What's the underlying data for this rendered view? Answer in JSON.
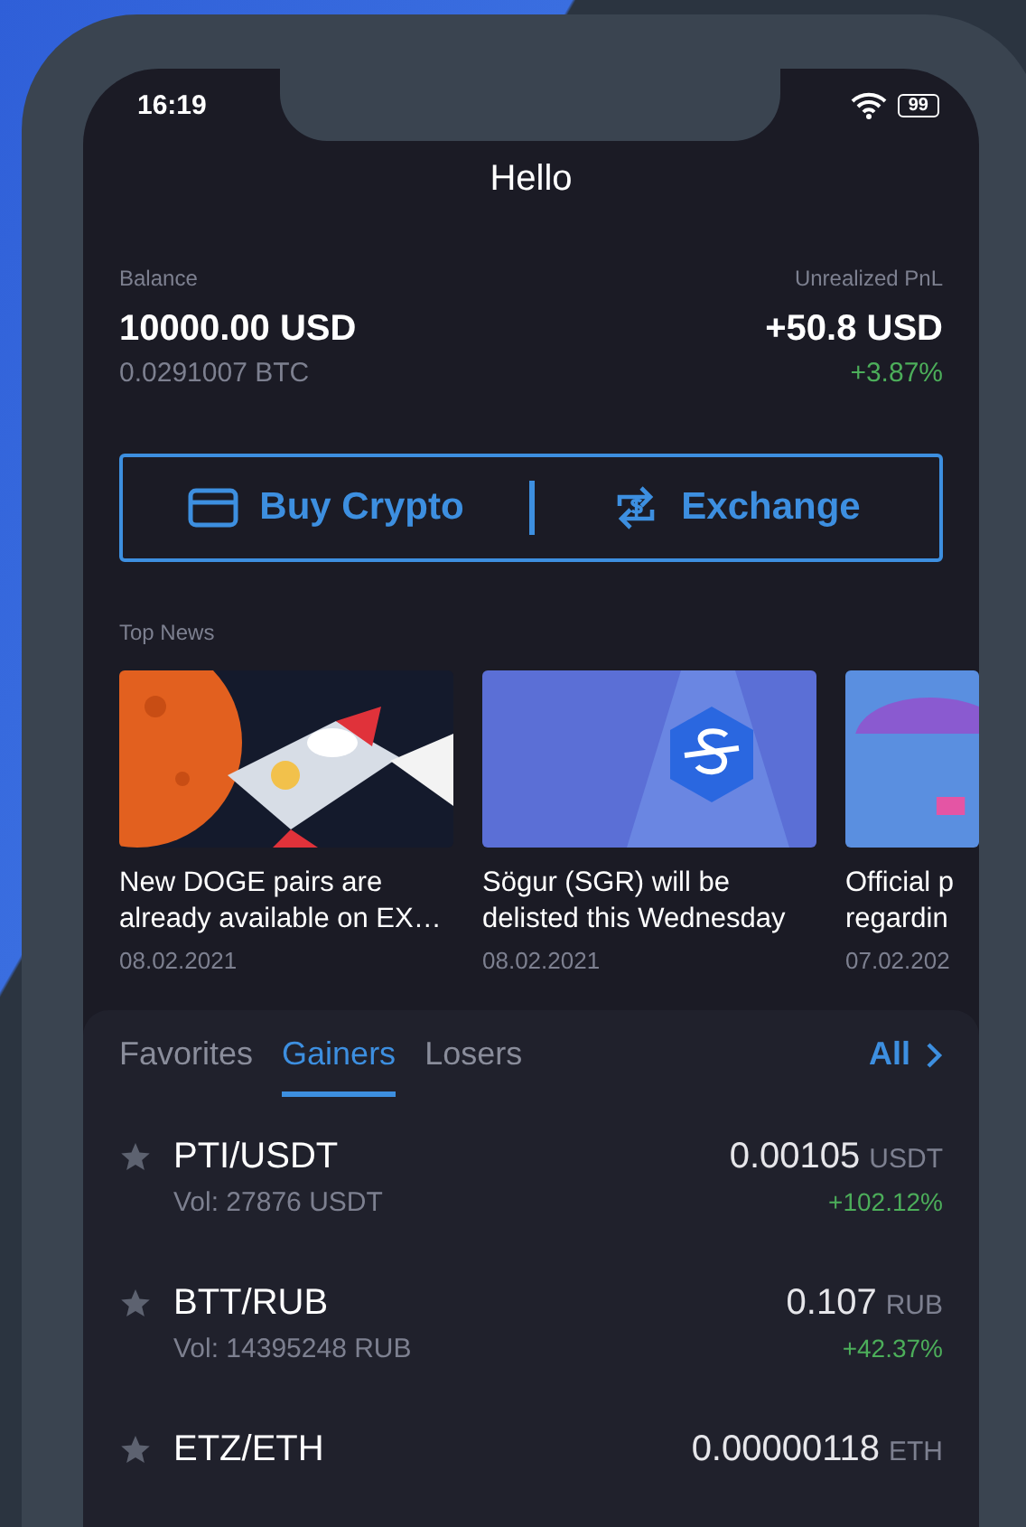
{
  "status_bar": {
    "time": "16:19",
    "battery": "99"
  },
  "title": "Hello",
  "balance": {
    "label": "Balance",
    "amount": "10000.00 USD",
    "btc": "0.0291007 BTC"
  },
  "pnl": {
    "label": "Unrealized PnL",
    "amount": "+50.8 USD",
    "percent": "+3.87%"
  },
  "actions": [
    {
      "label": "Buy Crypto",
      "kind": "card"
    },
    {
      "label": "Exchange",
      "kind": "exchange"
    }
  ],
  "news": {
    "title": "Top News",
    "items": [
      {
        "title": "New DOGE pairs are already available on EX…",
        "date": "08.02.2021",
        "kind": "rocket"
      },
      {
        "title": "Sögur (SGR) will be delisted this Wednesday",
        "date": "08.02.2021",
        "kind": "coin"
      },
      {
        "title": "Official p regardin",
        "date": "07.02.202",
        "kind": "parachute"
      }
    ]
  },
  "markets": {
    "tabs": [
      {
        "label": "Favorites",
        "selected": false
      },
      {
        "label": "Gainers",
        "selected": true
      },
      {
        "label": "Losers",
        "selected": false
      }
    ],
    "all_link": "All",
    "rows": [
      {
        "pair": "PTI/USDT",
        "volume": "Vol: 27876 USDT",
        "price": "0.00105",
        "unit": "USDT",
        "change": "+102.12%"
      },
      {
        "pair": "BTT/RUB",
        "volume": "Vol: 14395248 RUB",
        "price": "0.107",
        "unit": "RUB",
        "change": "+42.37%"
      },
      {
        "pair": "ETZ/ETH",
        "price": "0.00000118",
        "unit": "ETH"
      }
    ]
  }
}
